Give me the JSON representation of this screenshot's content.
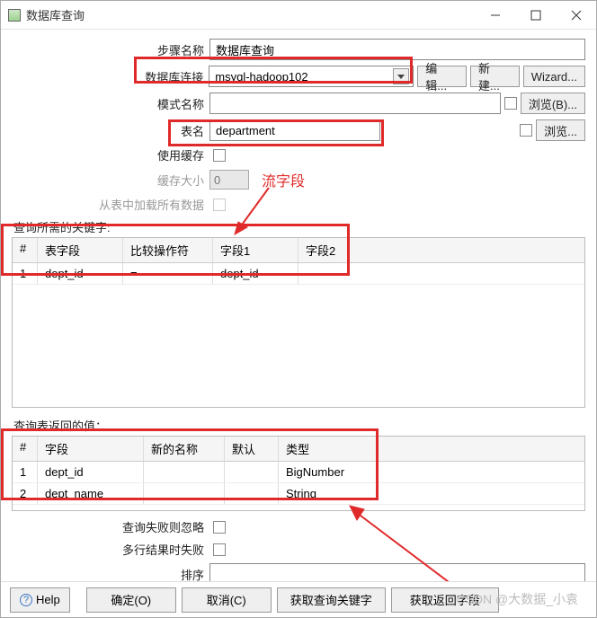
{
  "window": {
    "title": "数据库查询"
  },
  "winbtn": {
    "min": "min",
    "max": "max",
    "close": "close"
  },
  "labels": {
    "step_name": "步骤名称",
    "db_conn": "数据库连接",
    "schema": "模式名称",
    "table": "表名",
    "use_cache": "使用缓存",
    "cache_size": "缓存大小",
    "load_all": "从表中加载所有数据",
    "keys_section": "查询所需的关键字:",
    "ret_section": "查询表返回的值：",
    "fail_ignore": "查询失败则忽略",
    "multi_fail": "多行结果时失败",
    "sort": "排序"
  },
  "values": {
    "step_name": "数据库查询",
    "db_conn": "msyql-hadoop102",
    "schema": "",
    "table": "department",
    "cache_size": "0",
    "sort": ""
  },
  "buttons": {
    "edit": "编辑...",
    "new": "新建...",
    "wizard": "Wizard...",
    "browse": "浏览(B)...",
    "browse2": "浏览...",
    "help": "Help",
    "ok": "确定(O)",
    "cancel": "取消(C)",
    "get_keys": "获取查询关键字",
    "get_fields": "获取返回字段"
  },
  "annotation": {
    "stream_field": "流字段"
  },
  "keys_grid": {
    "headers": {
      "idx": "#",
      "c1": "表字段",
      "c2": "比较操作符",
      "c3": "字段1",
      "c4": "字段2"
    },
    "rows": [
      {
        "idx": "1",
        "c1": "dept_id",
        "c2": "=",
        "c3": "dept_id",
        "c4": ""
      }
    ]
  },
  "ret_grid": {
    "headers": {
      "idx": "#",
      "c1": "字段",
      "c2": "新的名称",
      "c3": "默认",
      "c4": "类型"
    },
    "rows": [
      {
        "idx": "1",
        "c1": "dept_id",
        "c2": "",
        "c3": "",
        "c4": "BigNumber"
      },
      {
        "idx": "2",
        "c1": "dept_name",
        "c2": "",
        "c3": "",
        "c4": "String"
      }
    ]
  },
  "watermark": "CSDN @大数据_小袁"
}
